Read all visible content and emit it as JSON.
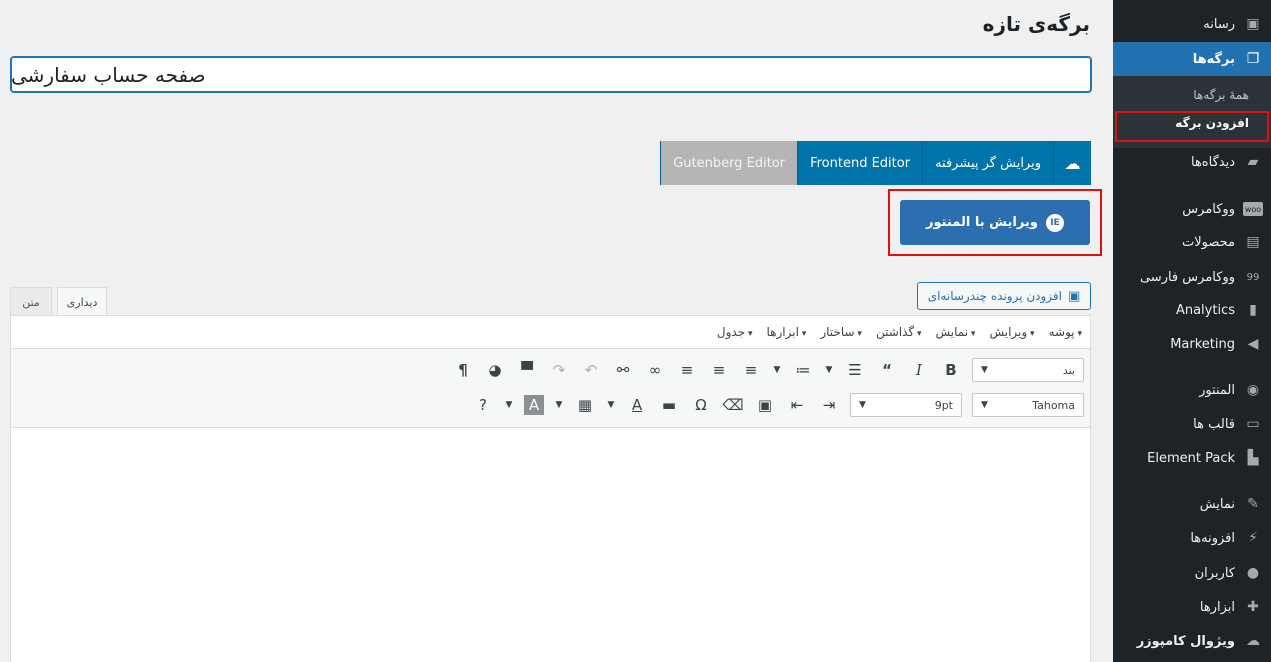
{
  "page": {
    "title": "برگه‌ی تازه",
    "title_input": "صفحه حساب سفارشی"
  },
  "sidebar": {
    "items": [
      {
        "label": "رسانه",
        "icon": "media-icon"
      },
      {
        "label": "برگه‌ها",
        "icon": "pages-icon",
        "active": true
      },
      {
        "label": "دیدگاه‌ها",
        "icon": "comments-icon"
      },
      {
        "label": "ووکامرس",
        "icon": "woocommerce-icon"
      },
      {
        "label": "محصولات",
        "icon": "products-icon"
      },
      {
        "label": "ووکامرس فارسی",
        "icon": "persian-woocommerce-icon"
      },
      {
        "label": "Analytics",
        "icon": "analytics-icon"
      },
      {
        "label": "Marketing",
        "icon": "marketing-icon"
      },
      {
        "label": "المنتور",
        "icon": "elementor-icon"
      },
      {
        "label": "قالب ها",
        "icon": "templates-icon"
      },
      {
        "label": "Element Pack",
        "icon": "element-pack-icon"
      },
      {
        "label": "نمایش",
        "icon": "appearance-icon"
      },
      {
        "label": "افزونه‌ها",
        "icon": "plugins-icon"
      },
      {
        "label": "کاربران",
        "icon": "users-icon"
      },
      {
        "label": "ابزارها",
        "icon": "tools-icon"
      },
      {
        "label": "ویژوال کامپوزر",
        "icon": "visual-composer-icon"
      }
    ],
    "submenu": [
      {
        "label": "همهٔ برگه‌ها"
      },
      {
        "label": "افزودن برگه",
        "current": true
      }
    ]
  },
  "editor_buttons": {
    "vc_icon": "visual-composer-icon",
    "advanced": "ویرایش گر پیشرفته",
    "frontend": "Frontend Editor",
    "gutenberg": "Gutenberg Editor",
    "elementor": "ویرایش با المنتور"
  },
  "media_button": "افزودن پرونده چندرسانه‌ای",
  "tabs": {
    "visual": "دیداری",
    "text": "متن"
  },
  "menubar": [
    "پوشه",
    "ویرایش",
    "نمایش",
    "گذاشتن",
    "ساختار",
    "ابزارها",
    "جدول"
  ],
  "toolbar": {
    "format_select": "بند",
    "font_family": "Tahoma",
    "font_size": "9pt"
  },
  "colors": {
    "sidebar_bg": "#1d2327",
    "accent": "#2271b1",
    "highlight_box": "#e01010"
  }
}
